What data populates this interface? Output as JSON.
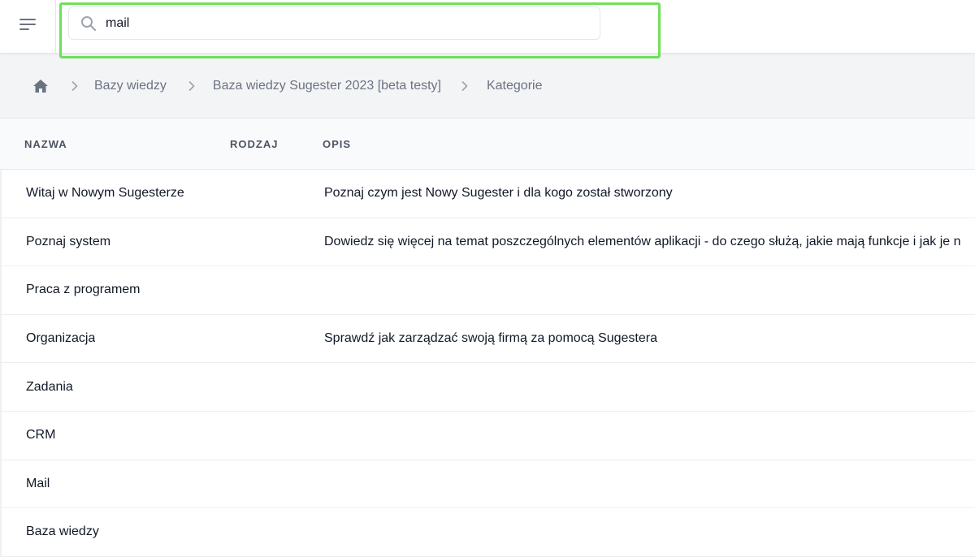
{
  "header": {
    "menu_icon": "hamburger-menu-icon",
    "search": {
      "icon": "search-icon",
      "value": "mail"
    }
  },
  "breadcrumb": {
    "home_icon": "home-icon",
    "separator_icon": "chevron-right-icon",
    "items": [
      {
        "label": "Bazy wiedzy"
      },
      {
        "label": "Baza wiedzy Sugester 2023 [beta testy]"
      },
      {
        "label": "Kategorie"
      }
    ]
  },
  "table": {
    "columns": [
      "NAZWA",
      "RODZAJ",
      "OPIS"
    ],
    "rows": [
      {
        "name": "Witaj w Nowym Sugesterze",
        "type": "",
        "description": "Poznaj czym jest Nowy Sugester i dla kogo został stworzony"
      },
      {
        "name": "Poznaj system",
        "type": "",
        "description": "Dowiedz się więcej na temat poszczególnych elementów aplikacji - do czego służą, jakie mają funkcje i jak je n"
      },
      {
        "name": "Praca z programem",
        "type": "",
        "description": ""
      },
      {
        "name": "Organizacja",
        "type": "",
        "description": "Sprawdź jak zarządzać swoją firmą za pomocą Sugestera"
      },
      {
        "name": "Zadania",
        "type": "",
        "description": ""
      },
      {
        "name": "CRM",
        "type": "",
        "description": ""
      },
      {
        "name": "Mail",
        "type": "",
        "description": ""
      },
      {
        "name": "Baza wiedzy",
        "type": "",
        "description": ""
      }
    ]
  },
  "colors": {
    "highlight": "#6fe05a",
    "breadcrumb_bg": "#f3f4f6",
    "text_muted": "#6b7280"
  }
}
